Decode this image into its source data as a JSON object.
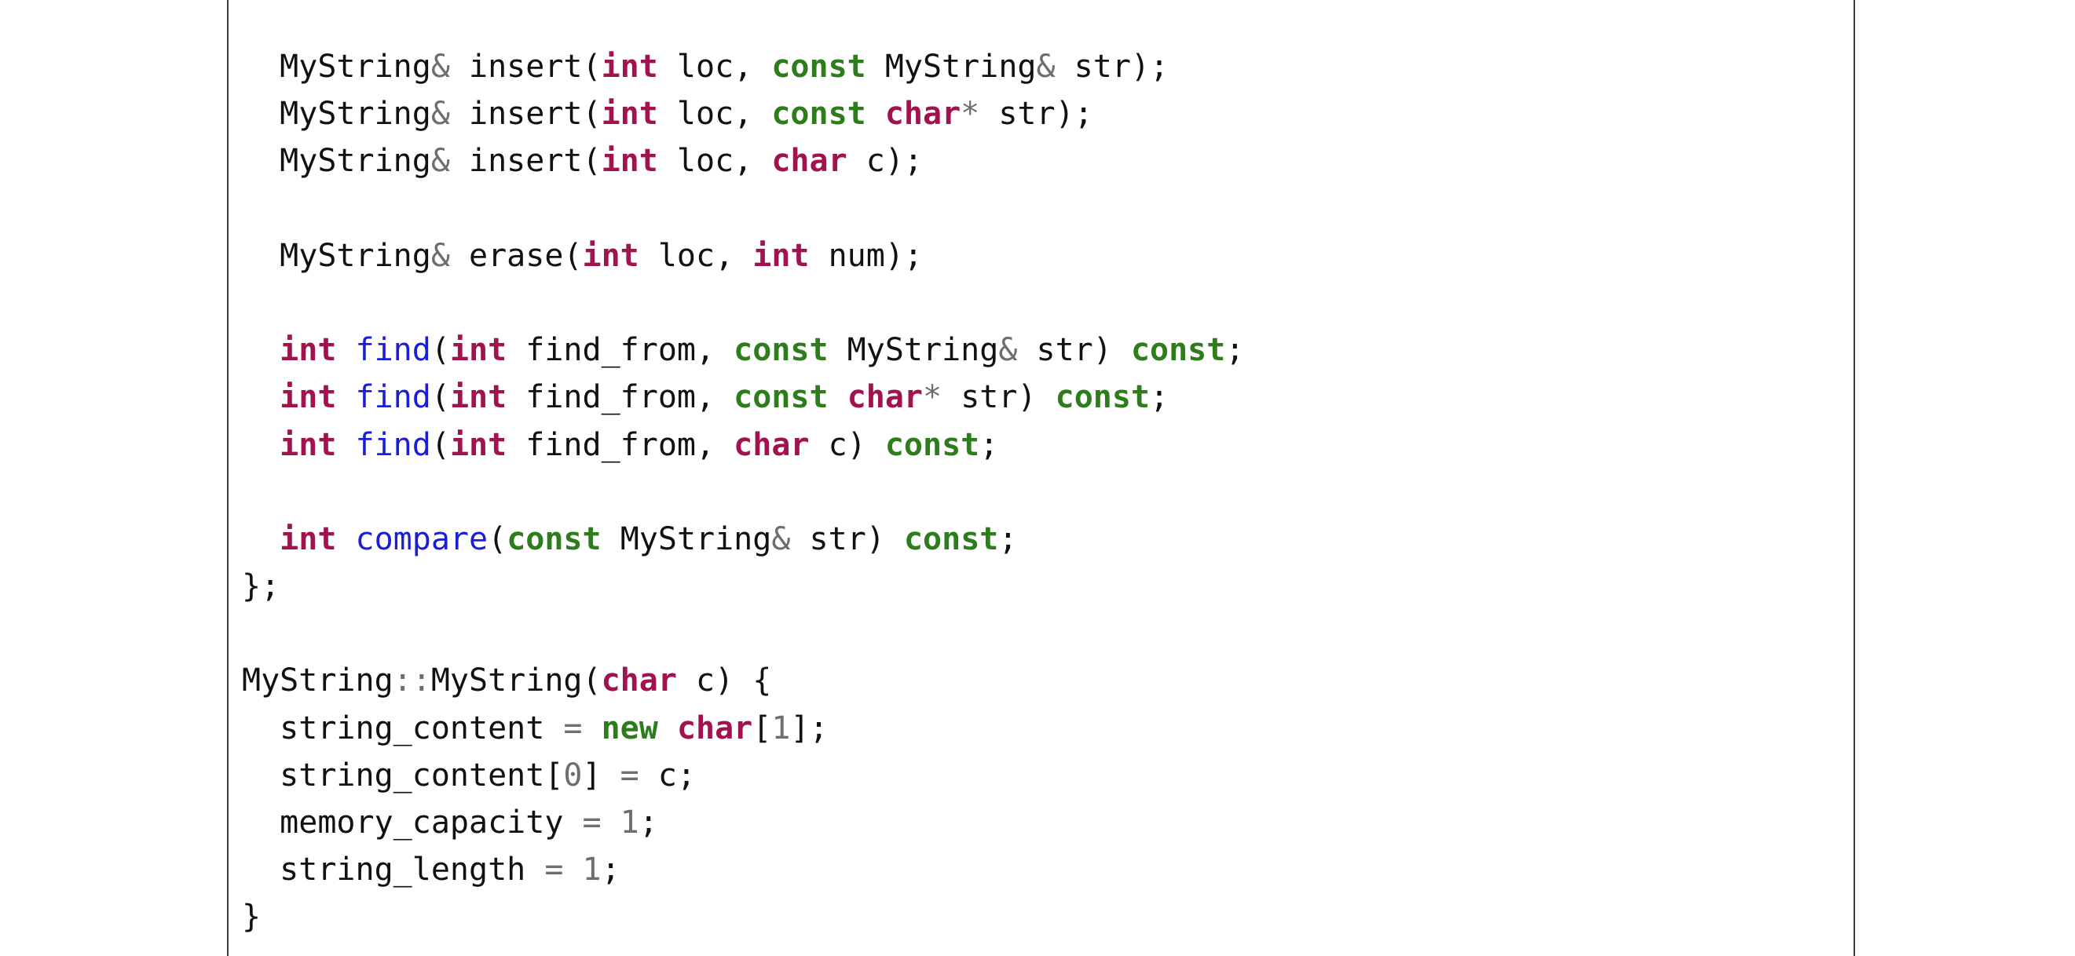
{
  "document": {
    "colors": {
      "type_keyword": "#a1134e",
      "qualifier_keyword": "#2e7d1c",
      "function_name": "#1a1fd6",
      "operator": "#6e6e6e",
      "number": "#6e6e6e",
      "text": "#111111"
    },
    "code_lines": [
      [
        [
          "plain",
          "  MyString"
        ],
        [
          "op",
          "&"
        ],
        [
          "plain",
          " insert("
        ],
        [
          "type",
          "int"
        ],
        [
          "plain",
          " loc, "
        ],
        [
          "kw",
          "const"
        ],
        [
          "plain",
          " MyString"
        ],
        [
          "op",
          "&"
        ],
        [
          "plain",
          " str);"
        ]
      ],
      [
        [
          "plain",
          "  MyString"
        ],
        [
          "op",
          "&"
        ],
        [
          "plain",
          " insert("
        ],
        [
          "type",
          "int"
        ],
        [
          "plain",
          " loc, "
        ],
        [
          "kw",
          "const"
        ],
        [
          "plain",
          " "
        ],
        [
          "type",
          "char"
        ],
        [
          "op",
          "*"
        ],
        [
          "plain",
          " str);"
        ]
      ],
      [
        [
          "plain",
          "  MyString"
        ],
        [
          "op",
          "&"
        ],
        [
          "plain",
          " insert("
        ],
        [
          "type",
          "int"
        ],
        [
          "plain",
          " loc, "
        ],
        [
          "type",
          "char"
        ],
        [
          "plain",
          " c);"
        ]
      ],
      [],
      [
        [
          "plain",
          "  MyString"
        ],
        [
          "op",
          "&"
        ],
        [
          "plain",
          " erase("
        ],
        [
          "type",
          "int"
        ],
        [
          "plain",
          " loc, "
        ],
        [
          "type",
          "int"
        ],
        [
          "plain",
          " num);"
        ]
      ],
      [],
      [
        [
          "plain",
          "  "
        ],
        [
          "type",
          "int"
        ],
        [
          "plain",
          " "
        ],
        [
          "fn",
          "find"
        ],
        [
          "plain",
          "("
        ],
        [
          "type",
          "int"
        ],
        [
          "plain",
          " find_from, "
        ],
        [
          "kw",
          "const"
        ],
        [
          "plain",
          " MyString"
        ],
        [
          "op",
          "&"
        ],
        [
          "plain",
          " str) "
        ],
        [
          "kw",
          "const"
        ],
        [
          "plain",
          ";"
        ]
      ],
      [
        [
          "plain",
          "  "
        ],
        [
          "type",
          "int"
        ],
        [
          "plain",
          " "
        ],
        [
          "fn",
          "find"
        ],
        [
          "plain",
          "("
        ],
        [
          "type",
          "int"
        ],
        [
          "plain",
          " find_from, "
        ],
        [
          "kw",
          "const"
        ],
        [
          "plain",
          " "
        ],
        [
          "type",
          "char"
        ],
        [
          "op",
          "*"
        ],
        [
          "plain",
          " str) "
        ],
        [
          "kw",
          "const"
        ],
        [
          "plain",
          ";"
        ]
      ],
      [
        [
          "plain",
          "  "
        ],
        [
          "type",
          "int"
        ],
        [
          "plain",
          " "
        ],
        [
          "fn",
          "find"
        ],
        [
          "plain",
          "("
        ],
        [
          "type",
          "int"
        ],
        [
          "plain",
          " find_from, "
        ],
        [
          "type",
          "char"
        ],
        [
          "plain",
          " c) "
        ],
        [
          "kw",
          "const"
        ],
        [
          "plain",
          ";"
        ]
      ],
      [],
      [
        [
          "plain",
          "  "
        ],
        [
          "type",
          "int"
        ],
        [
          "plain",
          " "
        ],
        [
          "fn",
          "compare"
        ],
        [
          "plain",
          "("
        ],
        [
          "kw",
          "const"
        ],
        [
          "plain",
          " MyString"
        ],
        [
          "op",
          "&"
        ],
        [
          "plain",
          " str) "
        ],
        [
          "kw",
          "const"
        ],
        [
          "plain",
          ";"
        ]
      ],
      [
        [
          "plain",
          "};"
        ]
      ],
      [],
      [
        [
          "plain",
          "MyString"
        ],
        [
          "op",
          "::"
        ],
        [
          "plain",
          "MyString("
        ],
        [
          "type",
          "char"
        ],
        [
          "plain",
          " c) {"
        ]
      ],
      [
        [
          "plain",
          "  string_content "
        ],
        [
          "op",
          "="
        ],
        [
          "plain",
          " "
        ],
        [
          "kw",
          "new"
        ],
        [
          "plain",
          " "
        ],
        [
          "type",
          "char"
        ],
        [
          "plain",
          "["
        ],
        [
          "num",
          "1"
        ],
        [
          "plain",
          "];"
        ]
      ],
      [
        [
          "plain",
          "  string_content["
        ],
        [
          "num",
          "0"
        ],
        [
          "plain",
          "] "
        ],
        [
          "op",
          "="
        ],
        [
          "plain",
          " c;"
        ]
      ],
      [
        [
          "plain",
          "  memory_capacity "
        ],
        [
          "op",
          "="
        ],
        [
          "plain",
          " "
        ],
        [
          "num",
          "1"
        ],
        [
          "plain",
          ";"
        ]
      ],
      [
        [
          "plain",
          "  string_length "
        ],
        [
          "op",
          "="
        ],
        [
          "plain",
          " "
        ],
        [
          "num",
          "1"
        ],
        [
          "plain",
          ";"
        ]
      ],
      [
        [
          "plain",
          "}"
        ]
      ]
    ]
  }
}
